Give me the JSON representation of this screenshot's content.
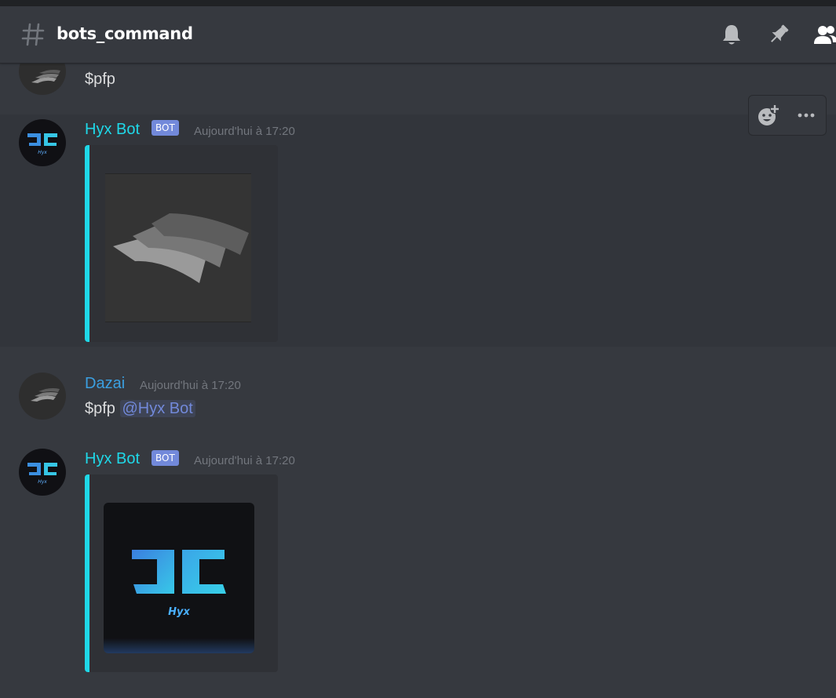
{
  "header": {
    "channel_name": "bots_command",
    "icons": [
      "hash-icon",
      "bell-icon",
      "pin-icon",
      "members-icon"
    ]
  },
  "hover_toolbar": {
    "icons": [
      "add-reaction-icon",
      "more-icon"
    ]
  },
  "messages": [
    {
      "kind": "continuation",
      "content": "$pfp"
    },
    {
      "kind": "bot",
      "username": "Hyx Bot",
      "badge": "BOT",
      "timestamp": "Aujourd'hui à 17:20",
      "embed_image": "dazai-avatar-image"
    },
    {
      "kind": "user",
      "username": "Dazai",
      "timestamp": "Aujourd'hui à 17:20",
      "content": "$pfp",
      "mention": "@Hyx Bot"
    },
    {
      "kind": "bot",
      "username": "Hyx Bot",
      "badge": "BOT",
      "timestamp": "Aujourd'hui à 17:20",
      "embed_image": "hyx-logo-image",
      "embed_logo_text": "Hyx"
    }
  ],
  "colors": {
    "bot_name": "#1fd8e8",
    "user_name": "#3b9fe0",
    "badge_bg": "#7289da",
    "embed_accent": "#1fd8e8",
    "background": "#36393f"
  }
}
